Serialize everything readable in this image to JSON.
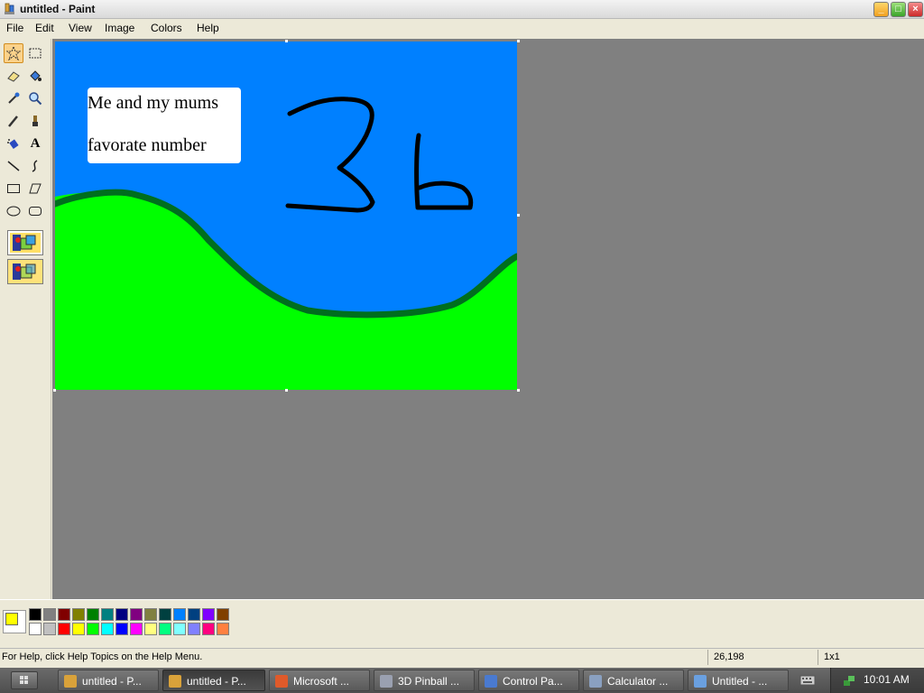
{
  "window": {
    "title": "untitled - Paint",
    "app_icon": "paint-brush-icon",
    "controls": [
      "minimize-icon",
      "maximize-icon",
      "close-icon"
    ]
  },
  "menu": [
    "File",
    "Edit",
    "View",
    "Image",
    "Colors",
    "Help"
  ],
  "tools": [
    {
      "name": "free-form-select",
      "icon": "star-select-icon",
      "selected": true
    },
    {
      "name": "select",
      "icon": "rect-select-icon"
    },
    {
      "name": "eraser",
      "icon": "eraser-icon"
    },
    {
      "name": "fill-with-color",
      "icon": "paint-bucket-icon"
    },
    {
      "name": "pick-color",
      "icon": "eyedropper-icon"
    },
    {
      "name": "magnifier",
      "icon": "magnifier-icon"
    },
    {
      "name": "pencil",
      "icon": "pencil-icon"
    },
    {
      "name": "brush",
      "icon": "brush-icon"
    },
    {
      "name": "airbrush",
      "icon": "airbrush-icon"
    },
    {
      "name": "text",
      "icon": "text-icon",
      "glyph": "A"
    },
    {
      "name": "line",
      "icon": "line-icon"
    },
    {
      "name": "curve",
      "icon": "curve-icon"
    },
    {
      "name": "rectangle",
      "icon": "rectangle-icon"
    },
    {
      "name": "polygon",
      "icon": "polygon-icon"
    },
    {
      "name": "ellipse",
      "icon": "ellipse-icon"
    },
    {
      "name": "rounded-rectangle",
      "icon": "rounded-rect-icon"
    }
  ],
  "canvas": {
    "note_line_1": "Me and my mums",
    "note_line_2": "favorate number",
    "sky_color": "#0080ff",
    "grass_color": "#00ff00",
    "hill_outline_color": "#006e1e",
    "handwritten_number": "36"
  },
  "colors": {
    "foreground": "#ffff00",
    "background": "#ffffff",
    "palette_top": [
      "#000000",
      "#808080",
      "#800000",
      "#808000",
      "#008000",
      "#008080",
      "#000080",
      "#800080",
      "#808040",
      "#004040",
      "#0080ff",
      "#004080",
      "#8000ff",
      "#804000"
    ],
    "palette_bottom": [
      "#ffffff",
      "#c0c0c0",
      "#ff0000",
      "#ffff00",
      "#00ff00",
      "#00ffff",
      "#0000ff",
      "#ff00ff",
      "#ffff80",
      "#00ff80",
      "#80ffff",
      "#8080ff",
      "#ff0080",
      "#ff8040"
    ]
  },
  "status": {
    "help": "For Help, click Help Topics on the Help Menu.",
    "coords": "26,198",
    "size": "1x1"
  },
  "taskbar": {
    "tasks": [
      {
        "label": "untitled - P...",
        "icon": "paint-icon",
        "active": false
      },
      {
        "label": "untitled - P...",
        "icon": "paint-icon",
        "active": true
      },
      {
        "label": "Microsoft ...",
        "icon": "msn-icon",
        "active": false
      },
      {
        "label": "3D Pinball ...",
        "icon": "pinball-icon",
        "active": false
      },
      {
        "label": "Control Pa...",
        "icon": "control-panel-icon",
        "active": false
      },
      {
        "label": "Calculator ...",
        "icon": "calculator-icon",
        "active": false
      },
      {
        "label": "Untitled - ...",
        "icon": "notepad-icon",
        "active": false
      }
    ],
    "clock": "10:01 AM"
  }
}
